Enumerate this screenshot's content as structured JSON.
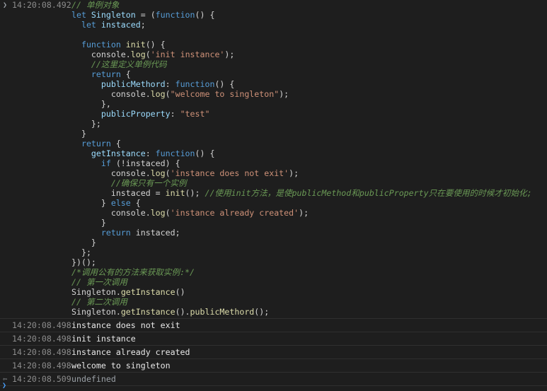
{
  "input_entry": {
    "prompt_icon": "chevron-right-icon",
    "timestamp": "14:20:08.492",
    "code_lines": [
      [
        {
          "t": "// 单例对象",
          "c": "c"
        }
      ],
      [
        {
          "t": "let ",
          "c": "k"
        },
        {
          "t": "Singleton",
          "c": "v"
        },
        {
          "t": " = (",
          "c": "p"
        },
        {
          "t": "function",
          "c": "k"
        },
        {
          "t": "() {",
          "c": "p"
        }
      ],
      [
        {
          "t": "  let ",
          "c": "k"
        },
        {
          "t": "instaced",
          "c": "v"
        },
        {
          "t": ";",
          "c": "p"
        }
      ],
      [],
      [
        {
          "t": "  function ",
          "c": "k"
        },
        {
          "t": "init",
          "c": "f"
        },
        {
          "t": "() {",
          "c": "p"
        }
      ],
      [
        {
          "t": "    console.",
          "c": "p"
        },
        {
          "t": "log",
          "c": "f"
        },
        {
          "t": "(",
          "c": "p"
        },
        {
          "t": "'init instance'",
          "c": "s"
        },
        {
          "t": ");",
          "c": "p"
        }
      ],
      [
        {
          "t": "    //这里定义单例代码",
          "c": "c"
        }
      ],
      [
        {
          "t": "    return ",
          "c": "k"
        },
        {
          "t": "{",
          "c": "p"
        }
      ],
      [
        {
          "t": "      publicMethord",
          "c": "v"
        },
        {
          "t": ": ",
          "c": "p"
        },
        {
          "t": "function",
          "c": "k"
        },
        {
          "t": "() {",
          "c": "p"
        }
      ],
      [
        {
          "t": "        console.",
          "c": "p"
        },
        {
          "t": "log",
          "c": "f"
        },
        {
          "t": "(",
          "c": "p"
        },
        {
          "t": "\"welcome to singleton\"",
          "c": "s"
        },
        {
          "t": ");",
          "c": "p"
        }
      ],
      [
        {
          "t": "      },",
          "c": "p"
        }
      ],
      [
        {
          "t": "      publicProperty",
          "c": "v"
        },
        {
          "t": ": ",
          "c": "p"
        },
        {
          "t": "\"test\"",
          "c": "s"
        }
      ],
      [
        {
          "t": "    };",
          "c": "p"
        }
      ],
      [
        {
          "t": "  }",
          "c": "p"
        }
      ],
      [
        {
          "t": "  return ",
          "c": "k"
        },
        {
          "t": "{",
          "c": "p"
        }
      ],
      [
        {
          "t": "    getInstance",
          "c": "v"
        },
        {
          "t": ": ",
          "c": "p"
        },
        {
          "t": "function",
          "c": "k"
        },
        {
          "t": "() {",
          "c": "p"
        }
      ],
      [
        {
          "t": "      if ",
          "c": "k"
        },
        {
          "t": "(!instaced) {",
          "c": "p"
        }
      ],
      [
        {
          "t": "        console.",
          "c": "p"
        },
        {
          "t": "log",
          "c": "f"
        },
        {
          "t": "(",
          "c": "p"
        },
        {
          "t": "'instance does not exit'",
          "c": "s"
        },
        {
          "t": ");",
          "c": "p"
        }
      ],
      [
        {
          "t": "        //确保只有一个实例",
          "c": "c"
        }
      ],
      [
        {
          "t": "        instaced = ",
          "c": "p"
        },
        {
          "t": "init",
          "c": "f"
        },
        {
          "t": "(); ",
          "c": "p"
        },
        {
          "t": "//使用init方法，是使publicMethod和publicProperty只在要使用的时候才初始化;",
          "c": "c"
        }
      ],
      [
        {
          "t": "      } ",
          "c": "p"
        },
        {
          "t": "else ",
          "c": "k"
        },
        {
          "t": "{",
          "c": "p"
        }
      ],
      [
        {
          "t": "        console.",
          "c": "p"
        },
        {
          "t": "log",
          "c": "f"
        },
        {
          "t": "(",
          "c": "p"
        },
        {
          "t": "'instance already created'",
          "c": "s"
        },
        {
          "t": ");",
          "c": "p"
        }
      ],
      [
        {
          "t": "      }",
          "c": "p"
        }
      ],
      [
        {
          "t": "      return ",
          "c": "k"
        },
        {
          "t": "instaced;",
          "c": "p"
        }
      ],
      [
        {
          "t": "    }",
          "c": "p"
        }
      ],
      [
        {
          "t": "  };",
          "c": "p"
        }
      ],
      [
        {
          "t": "})();",
          "c": "p"
        }
      ],
      [
        {
          "t": "/*调用公有的方法来获取实例:*/",
          "c": "c"
        }
      ],
      [
        {
          "t": "// 第一次调用",
          "c": "c"
        }
      ],
      [
        {
          "t": "Singleton.",
          "c": "p"
        },
        {
          "t": "getInstance",
          "c": "f"
        },
        {
          "t": "()",
          "c": "p"
        }
      ],
      [
        {
          "t": "// 第二次调用",
          "c": "c"
        }
      ],
      [
        {
          "t": "Singleton.",
          "c": "p"
        },
        {
          "t": "getInstance",
          "c": "f"
        },
        {
          "t": "().",
          "c": "p"
        },
        {
          "t": "publicMethord",
          "c": "f"
        },
        {
          "t": "();",
          "c": "p"
        }
      ]
    ]
  },
  "output_entries": [
    {
      "timestamp": "14:20:08.498",
      "message": "instance does not exit"
    },
    {
      "timestamp": "14:20:08.498",
      "message": "init instance"
    },
    {
      "timestamp": "14:20:08.498",
      "message": "instance already created"
    },
    {
      "timestamp": "14:20:08.498",
      "message": "welcome to singleton"
    }
  ],
  "result_entry": {
    "icon": "return-arrow-icon",
    "timestamp": "14:20:08.509",
    "value": "undefined"
  },
  "colors": {
    "background": "#1e1e1e",
    "keyword": "#569cd6",
    "string": "#ce9178",
    "comment": "#6a9955",
    "variable": "#9cdcfe",
    "function": "#dcdcaa",
    "timestamp": "#8c8c8c"
  }
}
